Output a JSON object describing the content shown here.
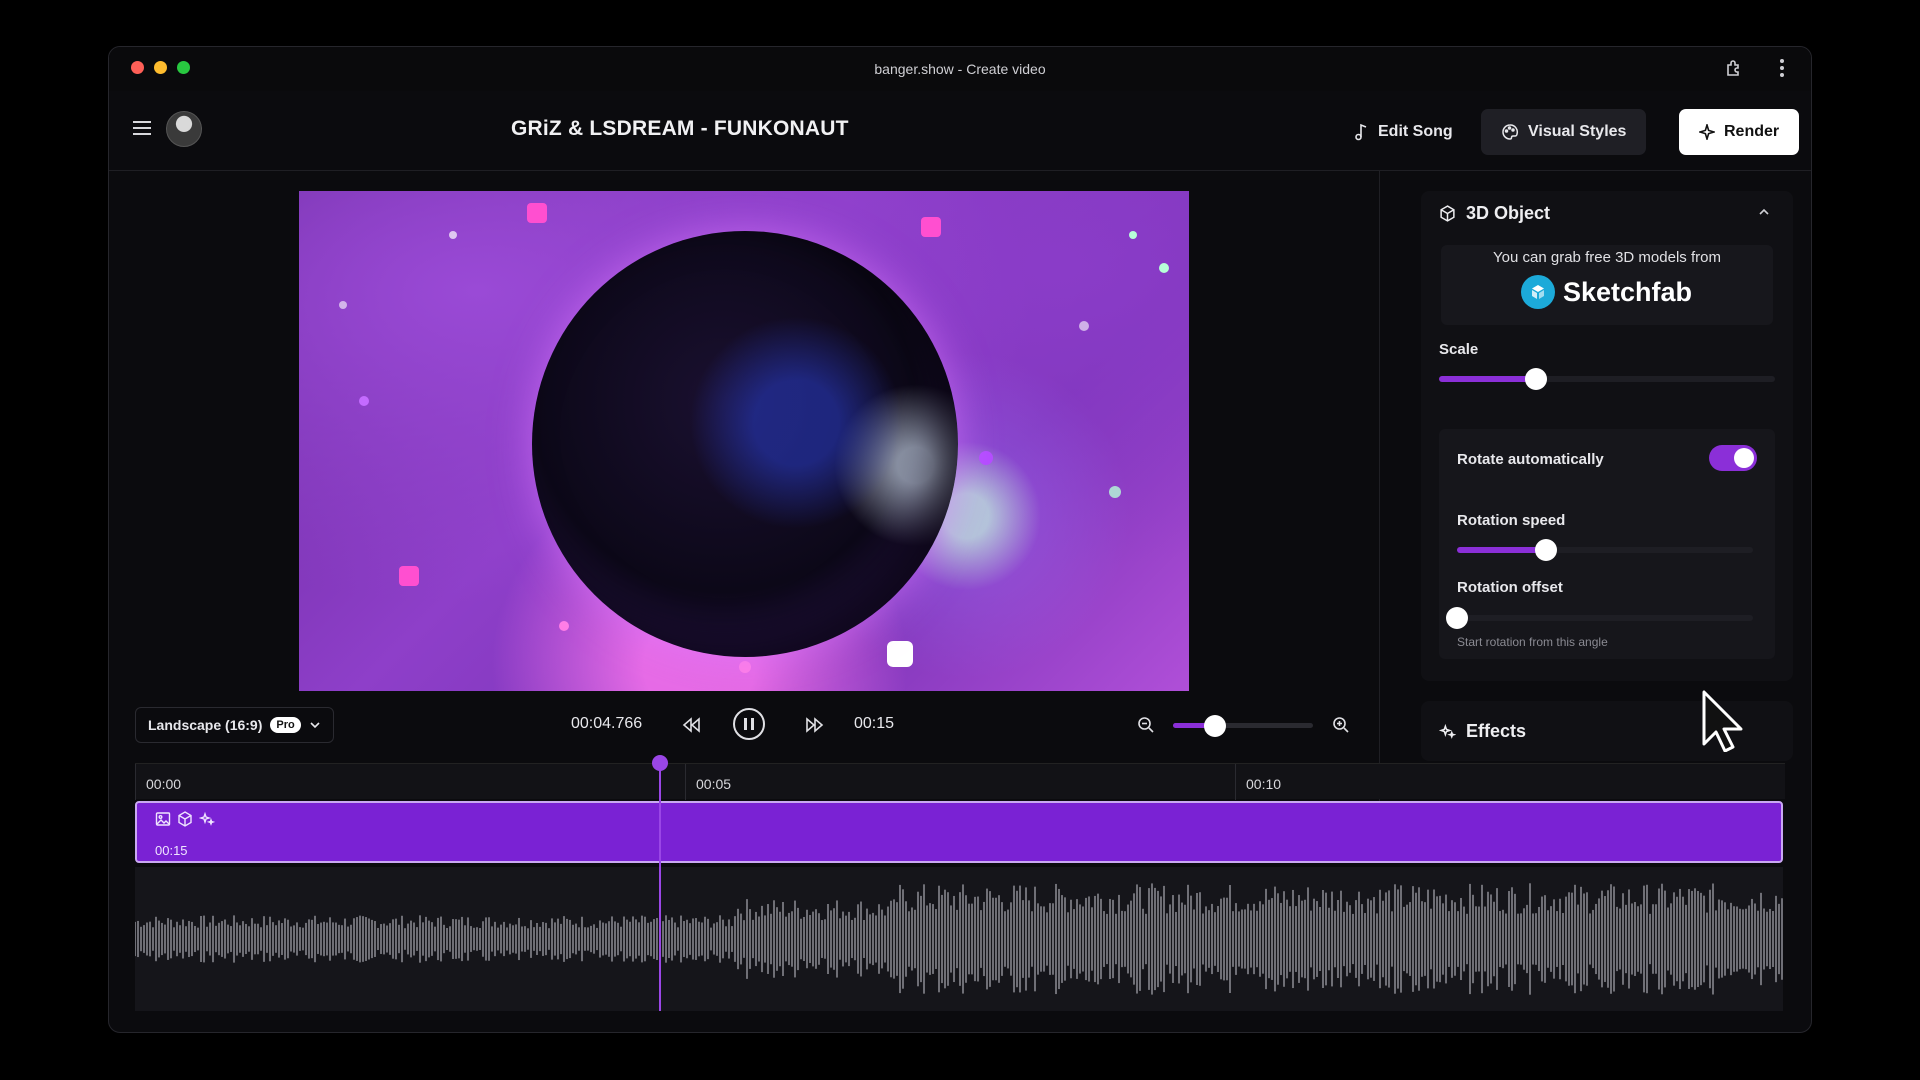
{
  "window": {
    "title": "banger.show - Create video"
  },
  "header": {
    "song_title": "GRiZ & LSDREAM - FUNKONAUT",
    "edit_song": "Edit Song",
    "visual_styles": "Visual Styles",
    "render": "Render"
  },
  "controls": {
    "aspect": "Landscape (16:9)",
    "pro_badge": "Pro",
    "current_time": "00:04.766",
    "end_time": "00:15",
    "zoom_level": 0.3
  },
  "timeline": {
    "ticks": [
      "00:00",
      "00:05",
      "00:10"
    ],
    "clip_duration": "00:15",
    "playhead_time_s": 4.766
  },
  "panel_3d": {
    "title": "3D Object",
    "grab_text": "You can grab free 3D models from",
    "brand": "Sketchfab",
    "scale_label": "Scale",
    "scale_value": 0.29,
    "rotate_auto_label": "Rotate automatically",
    "rotate_auto_on": true,
    "rotation_speed_label": "Rotation speed",
    "rotation_speed_value": 0.3,
    "rotation_offset_label": "Rotation offset",
    "rotation_offset_value": 0,
    "rotation_offset_hint": "Start rotation from this angle"
  },
  "effects": {
    "title": "Effects"
  },
  "colors": {
    "accent": "#8b2fd8",
    "clip": "#7a22d4"
  }
}
